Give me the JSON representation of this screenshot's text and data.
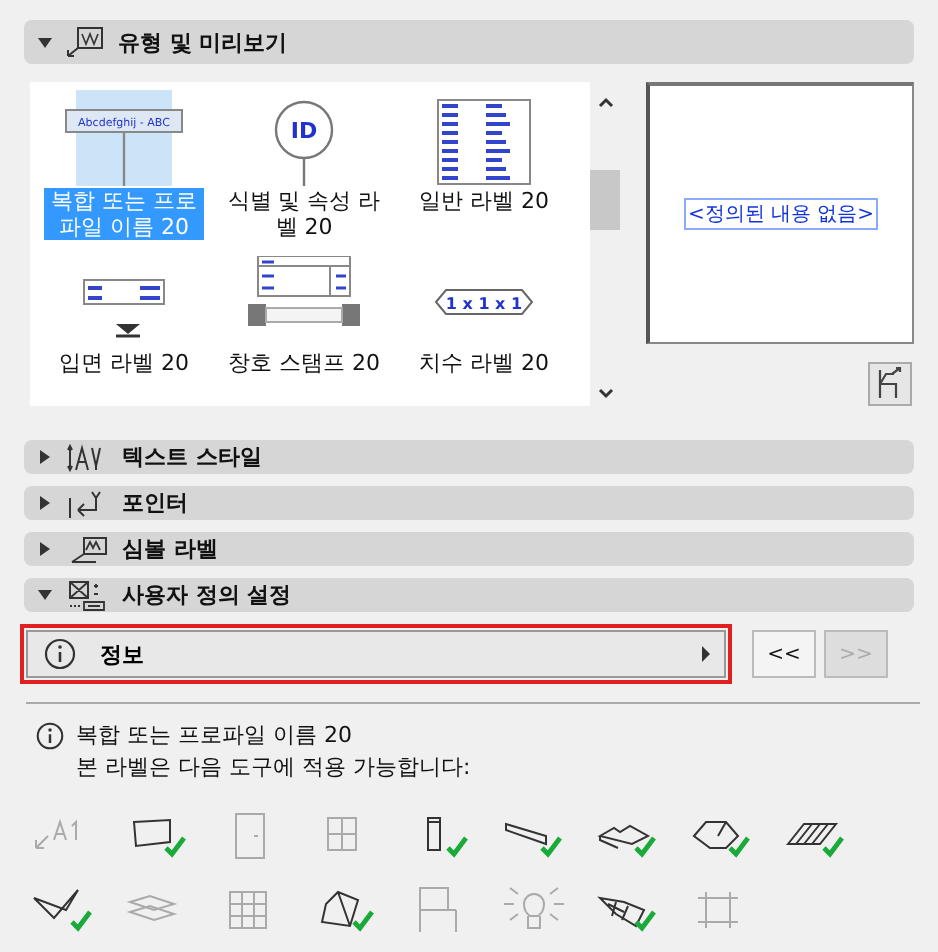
{
  "type_section": {
    "title": "유형 및 미리보기",
    "expanded": true
  },
  "gallery": [
    {
      "label": "복합 또는 프로파일 이름 20",
      "selected": true,
      "thumb_text": "Abcdefghij - ABC"
    },
    {
      "label": "식별 및 속성 라벨 20",
      "selected": false,
      "thumb_text": "ID"
    },
    {
      "label": "일반 라벨 20",
      "selected": false
    },
    {
      "label": "입면 라벨 20",
      "selected": false
    },
    {
      "label": "창호 스탬프 20",
      "selected": false
    },
    {
      "label": "치수 라벨 20",
      "selected": false,
      "thumb_text": "1 x 1 x 1"
    }
  ],
  "preview": {
    "text": "<정의된 내용 없음>"
  },
  "sections": [
    {
      "title": "텍스트 스타일",
      "expanded": false
    },
    {
      "title": "포인터",
      "expanded": false
    },
    {
      "title": "심볼 라벨",
      "expanded": false
    },
    {
      "title": "사용자 정의 설정",
      "expanded": true
    }
  ],
  "page_selector": {
    "label": "정보",
    "prev": "<<",
    "next": ">>",
    "next_disabled": true
  },
  "info": {
    "name": "복합 또는 프로파일 이름 20",
    "note": "본 라벨은 다음 도구에 적용 가능합니다:"
  },
  "tools": [
    {
      "applicable": false
    },
    {
      "applicable": true
    },
    {
      "applicable": false
    },
    {
      "applicable": false
    },
    {
      "applicable": true
    },
    {
      "applicable": true
    },
    {
      "applicable": true
    },
    {
      "applicable": true
    },
    {
      "applicable": true
    },
    {
      "applicable": true
    },
    {
      "applicable": false
    },
    {
      "applicable": false
    },
    {
      "applicable": true
    },
    {
      "applicable": false
    },
    {
      "applicable": false
    },
    {
      "applicable": true
    },
    {
      "applicable": false
    }
  ]
}
